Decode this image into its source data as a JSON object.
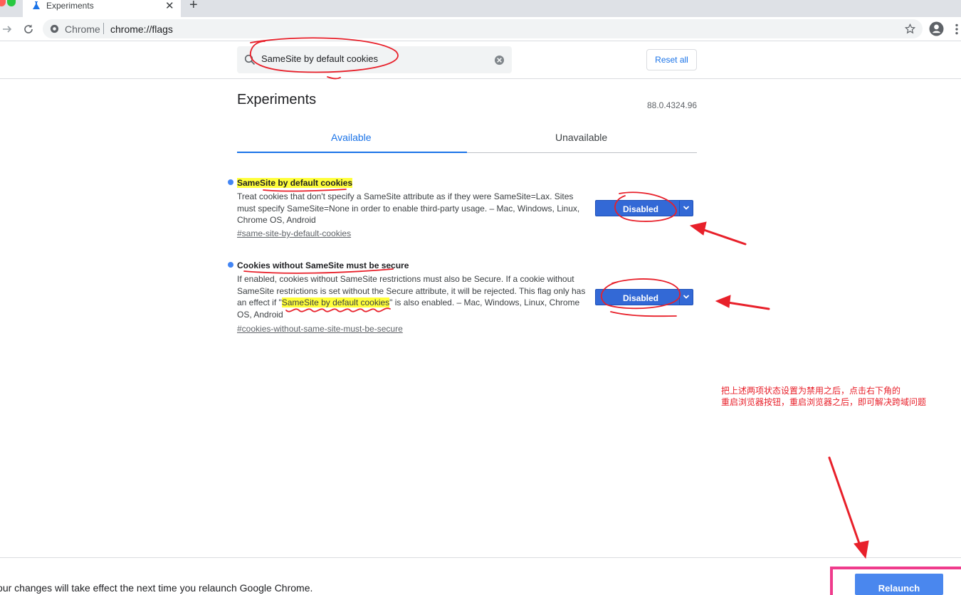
{
  "browser": {
    "tab_title": "Experiments",
    "tab_close": "✕",
    "new_tab": "+",
    "omnibox_site": "Chrome",
    "omnibox_url": "chrome://flags"
  },
  "header": {
    "search_value": "SameSite by default cookies",
    "reset_label": "Reset all"
  },
  "main": {
    "title": "Experiments",
    "version": "88.0.4324.96",
    "tabs": [
      {
        "label": "Available",
        "active": true
      },
      {
        "label": "Unavailable",
        "active": false
      }
    ],
    "experiments": [
      {
        "name": "SameSite by default cookies",
        "description": "Treat cookies that don't specify a SameSite attribute as if they were SameSite=Lax. Sites must specify SameSite=None in order to enable third-party usage. – Mac, Windows, Linux, Chrome OS, Android",
        "link": "#same-site-by-default-cookies",
        "value": "Disabled"
      },
      {
        "name": "Cookies without SameSite must be secure",
        "description_before": "If enabled, cookies without SameSite restrictions must also be Secure. If a cookie without SameSite restrictions is set without the Secure attribute, it will be rejected. This flag only has an effect if \"",
        "description_highlight": "SameSite by default cookies",
        "description_after": "\" is also enabled. – Mac, Windows, Linux, Chrome OS, Android",
        "link": "#cookies-without-same-site-must-be-secure",
        "value": "Disabled"
      }
    ]
  },
  "annotation": {
    "line1": "把上述两项状态设置为禁用之后，点击右下角的",
    "line2": "重启浏览器按钮，重启浏览器之后，即可解决跨域问题"
  },
  "footer": {
    "message": "Your changes will take effect the next time you relaunch Google Chrome.",
    "relaunch_label": "Relaunch"
  },
  "colors": {
    "accent": "#1a73e8",
    "select_bg": "#3369d6",
    "highlight": "#ffff3a",
    "annotation_red": "#e8202a",
    "relaunch_frame": "#ef3b8c"
  }
}
